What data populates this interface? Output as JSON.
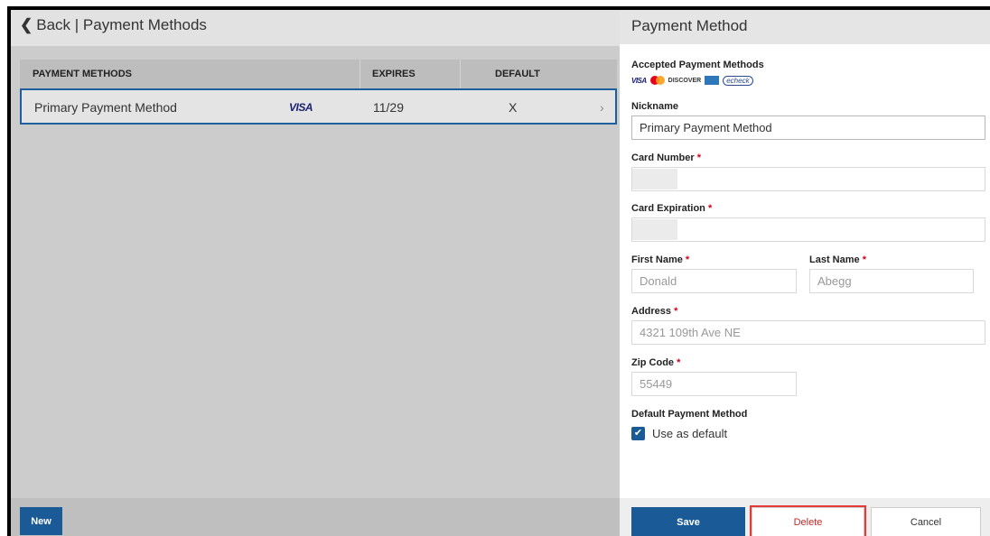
{
  "left": {
    "back_label": "Back | Payment Methods",
    "table": {
      "headers": [
        "PAYMENT METHODS",
        "EXPIRES",
        "DEFAULT"
      ],
      "rows": [
        {
          "name": "Primary Payment Method",
          "card_brand": "VISA",
          "expires": "11/29",
          "default": "X"
        }
      ]
    },
    "new_label": "New"
  },
  "panel": {
    "title": "Payment Method",
    "accepted_label": "Accepted Payment Methods",
    "accepted_logos": [
      "VISA",
      "mastercard",
      "DISCOVER",
      "amex",
      "echeck"
    ],
    "nickname_label": "Nickname",
    "nickname_value": "Primary Payment Method",
    "card_number_label": "Card Number",
    "card_expiration_label": "Card Expiration",
    "first_name_label": "First Name",
    "first_name_value": "Donald",
    "last_name_label": "Last Name",
    "last_name_value": "Abegg",
    "address_label": "Address",
    "address_value": "4321 109th Ave NE",
    "zip_label": "Zip Code",
    "zip_value": "55449",
    "default_label": "Default Payment Method",
    "use_default_label": "Use as default",
    "use_default_checked": true,
    "required_marker": "*"
  },
  "footer": {
    "save_label": "Save",
    "delete_label": "Delete",
    "cancel_label": "Cancel"
  },
  "colors": {
    "primary": "#1a5a96",
    "delete_text": "#c62828",
    "highlight": "#e53935",
    "required": "#d0021b"
  }
}
